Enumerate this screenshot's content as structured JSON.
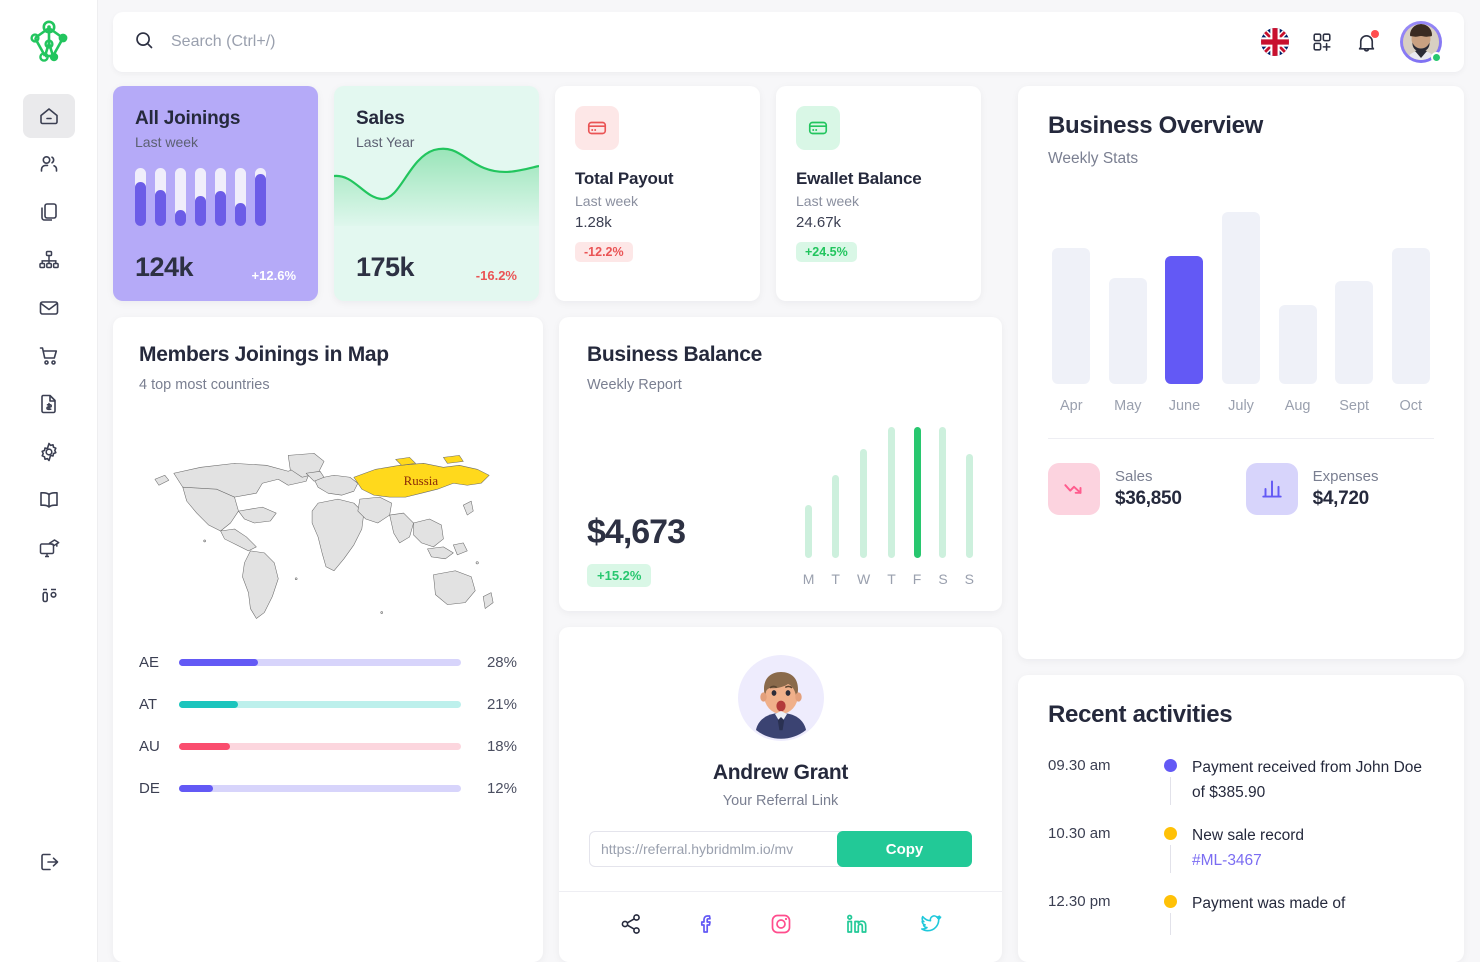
{
  "brand": {
    "logo_name": "network-logo",
    "accent": "#22c997"
  },
  "sidebar": {
    "items": [
      {
        "name": "home-icon",
        "label": "Dashboard",
        "active": true
      },
      {
        "name": "users-icon",
        "label": "Members",
        "active": false
      },
      {
        "name": "documents-icon",
        "label": "Reports",
        "active": false
      },
      {
        "name": "sitemap-icon",
        "label": "Genealogy",
        "active": false
      },
      {
        "name": "mail-icon",
        "label": "Mail",
        "active": false
      },
      {
        "name": "cart-icon",
        "label": "Shopping",
        "active": false
      },
      {
        "name": "invoice-dollar-icon",
        "label": "Payouts",
        "active": false
      },
      {
        "name": "gear-icon",
        "label": "Settings",
        "active": false
      },
      {
        "name": "book-icon",
        "label": "Training",
        "active": false
      },
      {
        "name": "monitor-graduation-icon",
        "label": "E-learning",
        "active": false
      },
      {
        "name": "toolbar-icon",
        "label": "Tools",
        "active": false
      }
    ],
    "logout": {
      "name": "logout-icon",
      "label": "Logout"
    }
  },
  "topbar": {
    "search_placeholder": "Search (Ctrl+/)",
    "search_value": "",
    "language_flag": "uk-flag",
    "apps_icon": "apps-grid-plus-icon",
    "notification_icon": "bell-icon",
    "notification_badge": true,
    "avatar": "user-avatar",
    "status": "online"
  },
  "stat_cards": {
    "all_joinings": {
      "title": "All Joinings",
      "subtitle": "Last week",
      "value": "124k",
      "delta": "+12.6%",
      "delta_direction": "up",
      "bg": "#b5aaf8"
    },
    "sales": {
      "title": "Sales",
      "subtitle": "Last Year",
      "value": "175k",
      "delta": "-16.2%",
      "delta_direction": "down",
      "bg": "#e3f8f0"
    },
    "total_payout": {
      "icon": "credit-card-icon",
      "title": "Total Payout",
      "subtitle": "Last week",
      "value": "1.28k",
      "badge": "-12.2%",
      "badge_tone": "red"
    },
    "ewallet_balance": {
      "icon": "credit-card-icon",
      "title": "Ewallet Balance",
      "subtitle": "Last week",
      "value": "24.67k",
      "badge": "+24.5%",
      "badge_tone": "green"
    }
  },
  "map_card": {
    "title": "Members Joinings in Map",
    "subtitle": "4 top most countries",
    "highlighted_country": "Russia",
    "countries": [
      {
        "code": "AE",
        "percent": "28%",
        "value": 28,
        "color": "#6359f5",
        "track": "#d7d4fb"
      },
      {
        "code": "AT",
        "percent": "21%",
        "value": 21,
        "color": "#1bc5bd",
        "track": "#bdf0ec"
      },
      {
        "code": "AU",
        "percent": "18%",
        "value": 18,
        "color": "#fa4d6e",
        "track": "#fcd6de"
      },
      {
        "code": "DE",
        "percent": "12%",
        "value": 12,
        "color": "#6359f5",
        "track": "#d7d4fb"
      }
    ]
  },
  "business_balance": {
    "title": "Business Balance",
    "subtitle": "Weekly Report",
    "amount": "$4,673",
    "badge": "+15.2%"
  },
  "referral": {
    "name": "Andrew Grant",
    "subtitle": "Your Referral Link",
    "link_placeholder": "https://referral.hybridmlm.io/mv",
    "link_value": "",
    "copy_label": "Copy",
    "socials": [
      {
        "name": "share-icon",
        "color": "#25293c"
      },
      {
        "name": "facebook-icon",
        "color": "#6359f5"
      },
      {
        "name": "instagram-icon",
        "color": "#ff4d8d"
      },
      {
        "name": "linkedin-icon",
        "color": "#22c997"
      },
      {
        "name": "twitter-icon",
        "color": "#1fc8db"
      }
    ]
  },
  "business_overview": {
    "title": "Business Overview",
    "subtitle": "Weekly Stats",
    "legend": [
      {
        "icon": "trend-down-icon",
        "label": "Sales",
        "value": "$36,850",
        "tone": "pink"
      },
      {
        "icon": "bar-chart-icon",
        "label": "Expenses",
        "value": "$4,720",
        "tone": "lavender"
      }
    ]
  },
  "recent_activities": {
    "title": "Recent activities",
    "items": [
      {
        "time": "09.30 am",
        "dot": "#6359f5",
        "text": "Payment received from John Doe of $385.90",
        "link": ""
      },
      {
        "time": "10.30 am",
        "dot": "#ffc107",
        "text": "New sale record ",
        "link": "#ML-3467"
      },
      {
        "time": "12.30 pm",
        "dot": "#ffc107",
        "text": "Payment was made of",
        "link": ""
      }
    ]
  },
  "chart_data": [
    {
      "type": "bar",
      "name": "business-overview-monthly",
      "title": "Business Overview",
      "subtitle": "Weekly Stats",
      "categories": [
        "Apr",
        "May",
        "June",
        "July",
        "Aug",
        "Sept",
        "Oct"
      ],
      "values": [
        62,
        48,
        58,
        78,
        36,
        47,
        62
      ],
      "highlight_index": 2,
      "highlight_color": "#6359f5",
      "base_color": "#eff1f8",
      "xlabel": "",
      "ylabel": "",
      "ylim": [
        0,
        100
      ],
      "grid": false,
      "legend": "none"
    },
    {
      "type": "bar",
      "name": "business-balance-weekly",
      "title": "Business Balance",
      "subtitle": "Weekly Report",
      "categories": [
        "M",
        "T",
        "W",
        "T",
        "F",
        "S",
        "S"
      ],
      "values": [
        33,
        52,
        68,
        85,
        100,
        85,
        65
      ],
      "highlight_index": 4,
      "highlight_color": "#28c76f",
      "base_color": "#cdf0dd",
      "ylim": [
        0,
        100
      ],
      "grid": false,
      "legend": "none"
    },
    {
      "type": "bar",
      "name": "all-joinings-mini",
      "title": "All Joinings",
      "categories": [
        "1",
        "2",
        "3",
        "4",
        "5",
        "6",
        "7"
      ],
      "values": [
        76,
        62,
        28,
        52,
        60,
        40,
        90
      ],
      "base_color": "#f0eefb",
      "highlight_color": "#6c5ce7",
      "ylim": [
        0,
        100
      ],
      "grid": false,
      "legend": "none"
    },
    {
      "type": "area",
      "name": "sales-trend",
      "title": "Sales",
      "subtitle": "Last Year",
      "x": [
        0,
        1,
        2,
        3,
        4,
        5,
        6,
        7,
        8
      ],
      "values": [
        55,
        48,
        36,
        30,
        45,
        72,
        80,
        72,
        62
      ],
      "line_color": "#22c55e",
      "ylim": [
        0,
        100
      ],
      "grid": false,
      "legend": "none"
    },
    {
      "type": "bar",
      "name": "country-joinings",
      "title": "Members Joinings in Map",
      "subtitle": "4 top most countries",
      "categories": [
        "AE",
        "AT",
        "AU",
        "DE"
      ],
      "values": [
        28,
        21,
        18,
        12
      ],
      "ylabel": "percent",
      "ylim": [
        0,
        100
      ],
      "grid": false,
      "legend": "none"
    }
  ]
}
